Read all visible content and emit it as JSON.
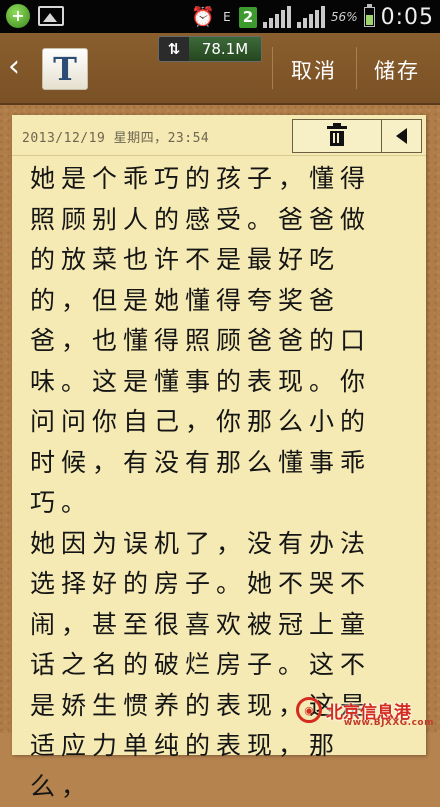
{
  "status_bar": {
    "battery_percent": "56%",
    "time": "0:05",
    "network_type": "E",
    "sim_slot": "2"
  },
  "action_bar": {
    "memory_indicator": "78.1M",
    "cancel_label": "取消",
    "save_label": "储存",
    "app_icon_letter": "T"
  },
  "note": {
    "datetime": "2013/12/19  星期四，23:54",
    "body": "她是个乖巧的孩子，懂得照顾别人的感受。爸爸做的放菜也许不是最好吃的，但是她懂得夸奖爸爸，也懂得照顾爸爸的口味。这是懂事的表现。你问问你自己，你那么小的时候，有没有那么懂事乖巧。\n她因为误机了，没有办法选择好的房子。她不哭不\n闹，甚至很喜欢被冠上童话之名的破烂房子。这不是娇生惯养的表现，这是适应力单纯的表现，那么，"
  },
  "watermark": {
    "text": "北京信息港",
    "url": "www.BJXXG.com"
  }
}
